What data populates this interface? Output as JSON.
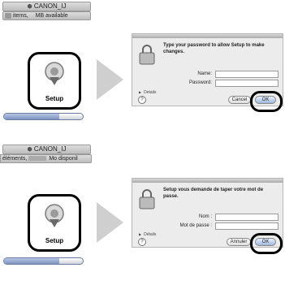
{
  "panels": [
    {
      "language": "en",
      "finder": {
        "title": "CANON_IJ",
        "status_items": "items,",
        "status_available": "MB available"
      },
      "setup_label": "Setup",
      "dialog": {
        "message": "Type your password to allow Setup to make changes.",
        "name_label": "Name:",
        "password_label": "Password:",
        "details_label": "Details",
        "help_icon": "?",
        "cancel_label": "Cancel",
        "ok_label": "OK"
      },
      "progress_fraction": 0.7
    },
    {
      "language": "fr",
      "finder": {
        "title": "CANON_IJ",
        "status_items": "éléments,",
        "status_available": "Mo disponil"
      },
      "setup_label": "Setup",
      "dialog": {
        "message": "Setup vous demande de taper votre mot de passe.",
        "name_label": "Nom :",
        "password_label": "Mot de passe :",
        "details_label": "Détails",
        "help_icon": "?",
        "cancel_label": "Annuler",
        "ok_label": "OK"
      },
      "progress_fraction": 0.7
    }
  ]
}
